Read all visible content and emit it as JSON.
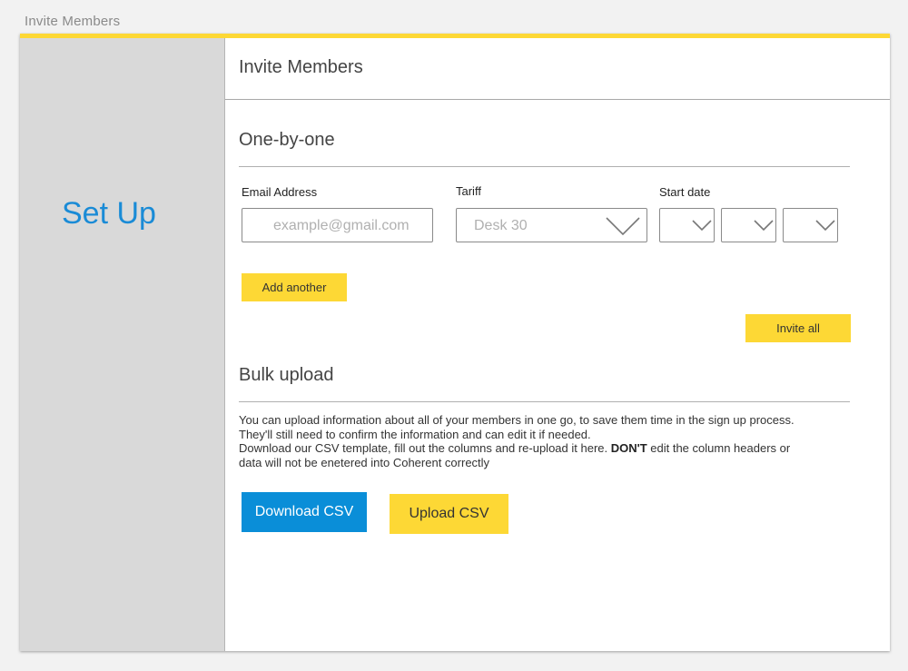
{
  "window": {
    "title": "Invite Members"
  },
  "sidebar": {
    "title": "Set Up"
  },
  "header": {
    "title": "Invite Members"
  },
  "one_by_one": {
    "title": "One-by-one",
    "email_label": "Email Address",
    "email_placeholder": "example@gmail.com",
    "tariff_label": "Tariff",
    "tariff_value": "Desk 30",
    "start_date_label": "Start date",
    "add_another_label": "Add another",
    "invite_all_label": "Invite all"
  },
  "bulk_upload": {
    "title": "Bulk upload",
    "desc_line1": "You can upload information about all of your members in one go, to save them time in the sign up process.",
    "desc_line2": "They'll still need to confirm the information and can edit it if needed.",
    "desc_line3_pre": "Download our CSV template, fill out the columns and re-upload it here. ",
    "desc_line3_bold": "DON'T",
    "desc_line3_post": " edit the column headers or",
    "desc_line4": "data will not be enetered into Coherent correctly",
    "download_label": "Download CSV",
    "upload_label": "Upload CSV"
  },
  "colors": {
    "accent_yellow": "#fdd835",
    "primary_blue": "#0a8ed8",
    "sidebar_title_blue": "#1a8bd6",
    "sidebar_bg": "#d9d9d9"
  },
  "icons": {
    "dropdown": "chevron-down-icon"
  }
}
